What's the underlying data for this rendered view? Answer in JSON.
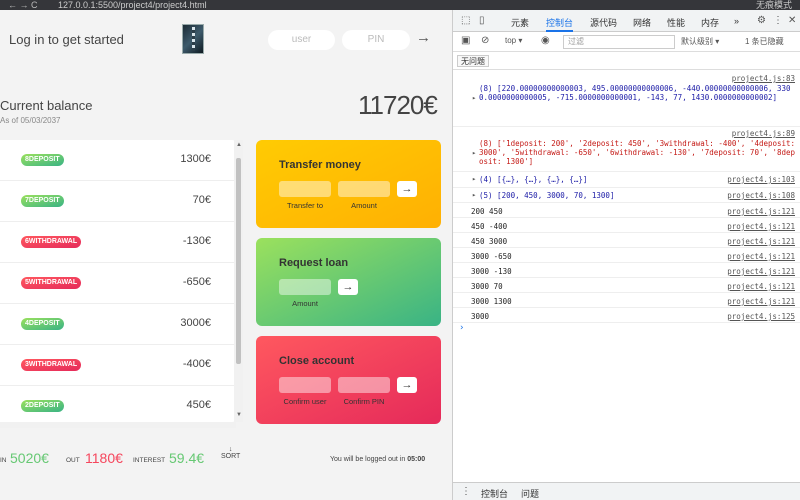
{
  "browser": {
    "url": "127.0.0.1:5500/project4/project4.html",
    "mode": "无痕模式"
  },
  "app": {
    "welcome": "Log in to get started",
    "login": {
      "user_placeholder": "user",
      "pin_placeholder": "PIN",
      "submit": "→"
    },
    "balance": {
      "label": "Current balance",
      "date": "As of 05/03/2037",
      "value": "11720€"
    },
    "movements": [
      {
        "type": "8DEPOSIT",
        "kind": "deposit",
        "value": "1300€"
      },
      {
        "type": "7DEPOSIT",
        "kind": "deposit",
        "value": "70€"
      },
      {
        "type": "6WITHDRAWAL",
        "kind": "withdrawal",
        "value": "-130€"
      },
      {
        "type": "5WITHDRAWAL",
        "kind": "withdrawal",
        "value": "-650€"
      },
      {
        "type": "4DEPOSIT",
        "kind": "deposit",
        "value": "3000€"
      },
      {
        "type": "3WITHDRAWAL",
        "kind": "withdrawal",
        "value": "-400€"
      },
      {
        "type": "2DEPOSIT",
        "kind": "deposit",
        "value": "450€"
      }
    ],
    "transfer": {
      "title": "Transfer money",
      "to_label": "Transfer to",
      "amount_label": "Amount",
      "submit": "→"
    },
    "loan": {
      "title": "Request loan",
      "amount_label": "Amount",
      "submit": "→"
    },
    "close": {
      "title": "Close account",
      "user_label": "Confirm user",
      "pin_label": "Confirm PIN",
      "submit": "→"
    },
    "summary": {
      "in_label": "IN",
      "in_value": "5020€",
      "out_label": "OUT",
      "out_value": "1180€",
      "interest_label": "INTEREST",
      "interest_value": "59.4€",
      "sort_arrow": "↓",
      "sort_label": "SORT",
      "timer_text": "You will be logged out in",
      "timer_value": "05:00"
    },
    "colors": {
      "deposit": "#39b385",
      "withdrawal": "#e52a5a",
      "transfer": "#ffb003",
      "in": "#66c873",
      "out": "#f5465d"
    }
  },
  "devtools": {
    "tabs": [
      "元素",
      "控制台",
      "源代码",
      "网络",
      "性能",
      "内存",
      "»"
    ],
    "active_tab": "控制台",
    "context": "top ▾",
    "filter_placeholder": "过滤",
    "level": "默认级别 ▾",
    "hidden_count": "1 条已隐藏",
    "issues_label": "无问题",
    "logs": [
      {
        "src": "project4.js:83",
        "text": "(8) [220.00000000000003, 495.00000000000006, -440.00000000000006, 3300.0000000000005, -715.0000000000001, -143, 77, 1430.0000000000002]",
        "style": "num"
      },
      {
        "src": "project4.js:89",
        "text": "(8) ['1deposit: 200', '2deposit: 450', '3withdrawal: -400', '4deposit: 3000', '5withdrawal: -650', '6withdrawal: -130', '7deposit: 70', '8deposit: 1300']",
        "style": "str"
      },
      {
        "src": "project4.js:103",
        "text": "(4) [{…}, {…}, {…}, {…}]",
        "style": "num"
      },
      {
        "src": "project4.js:108",
        "text": "(5) [200, 450, 3000, 70, 1300]",
        "style": "num"
      }
    ],
    "plain_logs": [
      {
        "text": "200 450",
        "src": "project4.js:121"
      },
      {
        "text": "450 -400",
        "src": "project4.js:121"
      },
      {
        "text": "450 3000",
        "src": "project4.js:121"
      },
      {
        "text": "3000 -650",
        "src": "project4.js:121"
      },
      {
        "text": "3000 -130",
        "src": "project4.js:121"
      },
      {
        "text": "3000 70",
        "src": "project4.js:121"
      },
      {
        "text": "3000 1300",
        "src": "project4.js:121"
      },
      {
        "text": "3000",
        "src": "project4.js:125"
      }
    ],
    "bottom_tabs": [
      "控制台",
      "问题"
    ]
  }
}
